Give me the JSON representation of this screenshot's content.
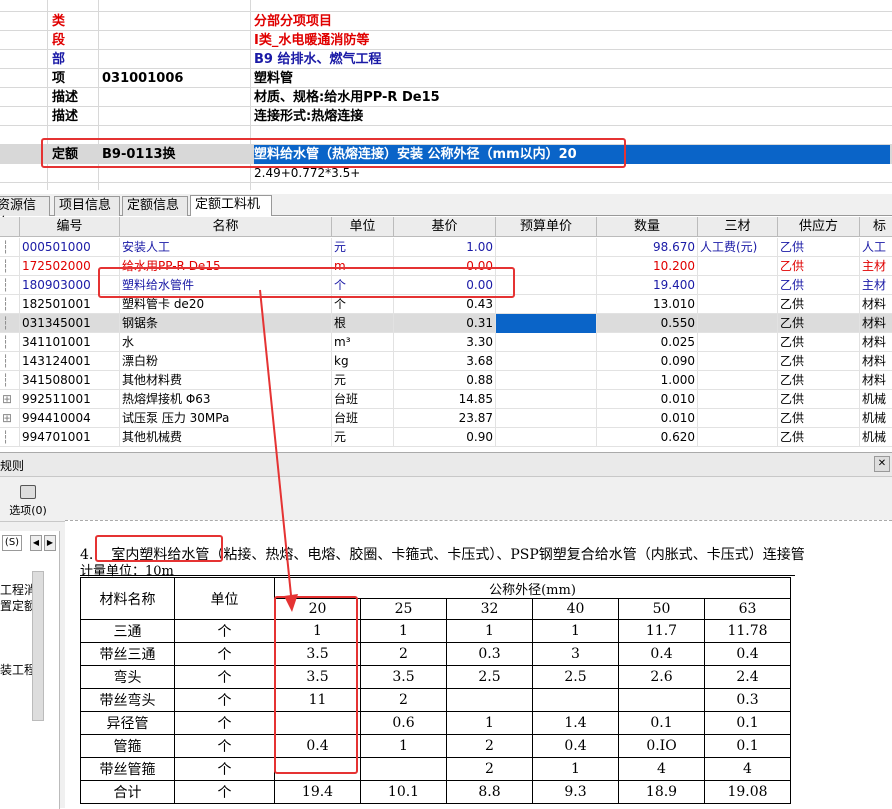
{
  "top_rows": [
    {
      "type": "类",
      "code": "",
      "name": "分部分项项目",
      "red": true
    },
    {
      "type": "段",
      "code": "",
      "name": "Ⅰ类_水电暖通消防等",
      "red": true
    },
    {
      "type": "部",
      "code": "",
      "name": "B9  给排水、燃气工程",
      "red": false
    },
    {
      "type": "项",
      "code": "031001006",
      "name": "塑料管",
      "red": false
    },
    {
      "type": "描述",
      "code": "",
      "name": "材质、规格:给水用PP-R De15",
      "red": false
    },
    {
      "type": "描述",
      "code": "",
      "name": "连接形式:热熔连接",
      "red": false
    },
    {
      "type": "",
      "code": "",
      "name": "",
      "red": false
    },
    {
      "type": "定额",
      "code": "B9-0113换",
      "name": "塑料给水管（热熔连接）安装 公称外径（mm以内）20",
      "red": false
    },
    {
      "type": "",
      "code": "",
      "name": "2.49+0.772*3.5+",
      "red": false
    }
  ],
  "tabs": [
    "资源信息",
    "项目信息",
    "定额信息",
    "定额工料机"
  ],
  "grid": {
    "headers": [
      "编号",
      "名称",
      "单位",
      "基价",
      "预算单价",
      "数量",
      "三材",
      "供应方",
      "标"
    ],
    "rows": [
      {
        "code": "000501000",
        "name": "安装人工",
        "unit": "元",
        "base": "1.00",
        "budget": "",
        "qty": "98.670",
        "mat": "人工费(元)",
        "supply": "乙供",
        "std": "人工",
        "style": "blue"
      },
      {
        "code": "172502000",
        "name": "给水用PP-R De15",
        "unit": "m",
        "base": "0.00",
        "budget": "",
        "qty": "10.200",
        "mat": "",
        "supply": "乙供",
        "std": "主材",
        "style": "red"
      },
      {
        "code": "180903000",
        "name": "塑料给水管件",
        "unit": "个",
        "base": "0.00",
        "budget": "",
        "qty": "19.400",
        "mat": "",
        "supply": "乙供",
        "std": "主材",
        "style": "blue"
      },
      {
        "code": "182501001",
        "name": "塑料管卡 de20",
        "unit": "个",
        "base": "0.43",
        "budget": "",
        "qty": "13.010",
        "mat": "",
        "supply": "乙供",
        "std": "材料",
        "style": ""
      },
      {
        "code": "031345001",
        "name": "钢锯条",
        "unit": "根",
        "base": "0.31",
        "budget": "",
        "qty": "0.550",
        "mat": "",
        "supply": "乙供",
        "std": "材料",
        "style": "sel"
      },
      {
        "code": "341101001",
        "name": "水",
        "unit": "m³",
        "base": "3.30",
        "budget": "",
        "qty": "0.025",
        "mat": "",
        "supply": "乙供",
        "std": "材料",
        "style": ""
      },
      {
        "code": "143124001",
        "name": "漂白粉",
        "unit": "kg",
        "base": "3.68",
        "budget": "",
        "qty": "0.090",
        "mat": "",
        "supply": "乙供",
        "std": "材料",
        "style": ""
      },
      {
        "code": "341508001",
        "name": "其他材料费",
        "unit": "元",
        "base": "0.88",
        "budget": "",
        "qty": "1.000",
        "mat": "",
        "supply": "乙供",
        "std": "材料",
        "style": ""
      },
      {
        "code": "992511001",
        "name": "热熔焊接机 Φ63",
        "unit": "台班",
        "base": "14.85",
        "budget": "",
        "qty": "0.010",
        "mat": "",
        "supply": "乙供",
        "std": "机械",
        "style": "exp"
      },
      {
        "code": "994410004",
        "name": "试压泵 压力 30MPa",
        "unit": "台班",
        "base": "23.87",
        "budget": "",
        "qty": "0.010",
        "mat": "",
        "supply": "乙供",
        "std": "机械",
        "style": "exp"
      },
      {
        "code": "994701001",
        "name": "其他机械费",
        "unit": "元",
        "base": "0.90",
        "budget": "",
        "qty": "0.620",
        "mat": "",
        "supply": "乙供",
        "std": "机械",
        "style": ""
      }
    ]
  },
  "lower_panel": {
    "title": "规则",
    "options_label": "选项(0)",
    "left_tab": "(S)",
    "left_items": [
      "工程消",
      "置定额",
      "装工程"
    ]
  },
  "doc": {
    "heading_prefix": "4.",
    "heading_boxed": "室内塑料给水管",
    "heading_rest": "（粘接、热熔、电熔、胶圈、卡箍式、卡压式）、PSP钢塑复合给水管（内胀式、卡压式）连接管",
    "unit_line": "计量单位：10m",
    "col_material": "材料名称",
    "col_unit": "单位",
    "col_group": "公称外径(mm)",
    "diameters": [
      "20",
      "25",
      "32",
      "40",
      "50",
      "63"
    ],
    "rows": [
      {
        "name": "三通",
        "unit": "个",
        "vals": [
          "1",
          "1",
          "1",
          "1",
          "11.7",
          "11.78"
        ]
      },
      {
        "name": "带丝三通",
        "unit": "个",
        "vals": [
          "3.5",
          "2",
          "0.3",
          "3",
          "0.4",
          "0.4"
        ]
      },
      {
        "name": "弯头",
        "unit": "个",
        "vals": [
          "3.5",
          "3.5",
          "2.5",
          "2.5",
          "2.6",
          "2.4"
        ]
      },
      {
        "name": "带丝弯头",
        "unit": "个",
        "vals": [
          "11",
          "2",
          "",
          "",
          "",
          "0.3"
        ]
      },
      {
        "name": "异径管",
        "unit": "个",
        "vals": [
          "",
          "0.6",
          "1",
          "1.4",
          "0.1",
          "0.1"
        ]
      },
      {
        "name": "管箍",
        "unit": "个",
        "vals": [
          "0.4",
          "1",
          "2",
          "0.4",
          "0.IO",
          "0.1"
        ]
      },
      {
        "name": "带丝管箍",
        "unit": "个",
        "vals": [
          "",
          "",
          "2",
          "1",
          "4",
          "4"
        ]
      },
      {
        "name": "合计",
        "unit": "个",
        "vals": [
          "19.4",
          "10.1",
          "8.8",
          "9.3",
          "18.9",
          "19.08"
        ]
      }
    ]
  },
  "colors": {
    "red": "#e00000",
    "blue": "#1a1aa6",
    "select": "#0a64c8",
    "box": "#e53333"
  }
}
